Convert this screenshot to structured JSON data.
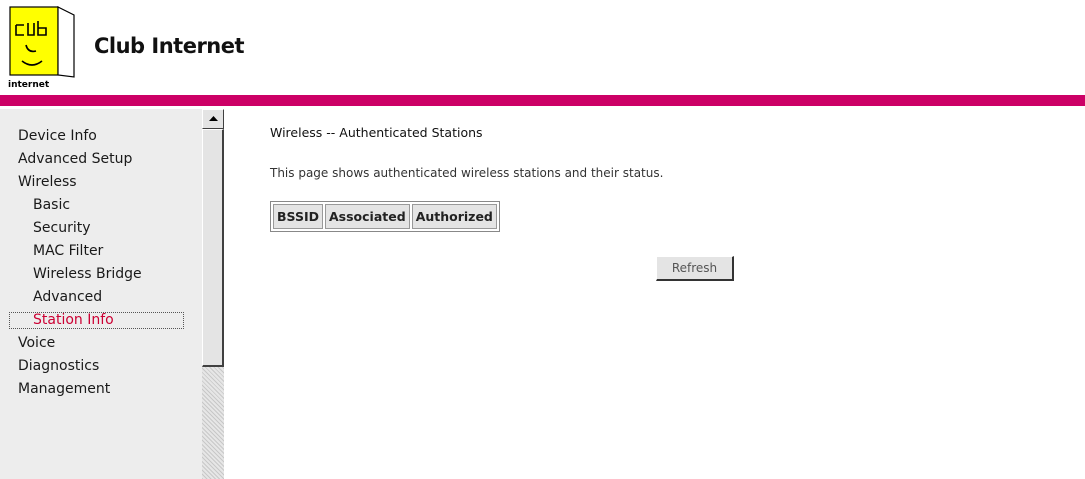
{
  "header": {
    "brand": "Club Internet",
    "logo_text": "internet"
  },
  "colors": {
    "accent_band": "#cc0066",
    "logo_yellow": "#ffff00",
    "active_nav": "#cc0033"
  },
  "sidebar": {
    "items": [
      {
        "label": "Device Info",
        "level": 0
      },
      {
        "label": "Advanced Setup",
        "level": 0
      },
      {
        "label": "Wireless",
        "level": 0
      },
      {
        "label": "Basic",
        "level": 1
      },
      {
        "label": "Security",
        "level": 1
      },
      {
        "label": "MAC Filter",
        "level": 1
      },
      {
        "label": "Wireless Bridge",
        "level": 1
      },
      {
        "label": "Advanced",
        "level": 1
      },
      {
        "label": "Station Info",
        "level": 1,
        "active": true
      },
      {
        "label": "Voice",
        "level": 0
      },
      {
        "label": "Diagnostics",
        "level": 0
      },
      {
        "label": "Management",
        "level": 0
      }
    ]
  },
  "main": {
    "title": "Wireless -- Authenticated Stations",
    "description": "This page shows authenticated wireless stations and their status.",
    "table": {
      "columns": [
        "BSSID",
        "Associated",
        "Authorized"
      ],
      "rows": []
    },
    "refresh_label": "Refresh"
  }
}
